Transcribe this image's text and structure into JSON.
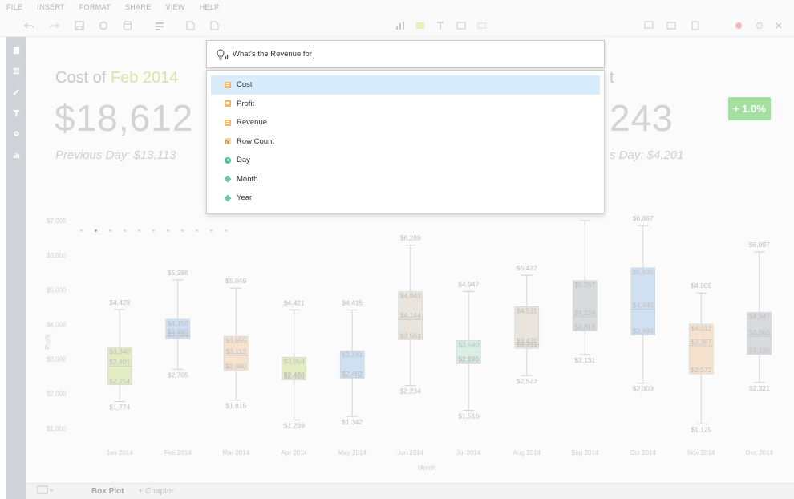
{
  "menu": [
    "FILE",
    "INSERT",
    "FORMAT",
    "SHARE",
    "VIEW",
    "HELP"
  ],
  "kpi_left": {
    "title_prefix": "Cost of ",
    "title_highlight": "Feb 2014",
    "value": "$18,612",
    "previous": "Previous Day: $13,113"
  },
  "kpi_right": {
    "title_partial": "t",
    "value_partial": "243",
    "previous_partial": "s Day: $4,201",
    "badge": "+ 1.0%"
  },
  "query": {
    "text": "What's the Revenue for"
  },
  "dropdown": [
    {
      "label": "Cost",
      "icon": "measure-icon",
      "selected": true
    },
    {
      "label": "Profit",
      "icon": "measure-icon",
      "selected": false
    },
    {
      "label": "Revenue",
      "icon": "measure-icon",
      "selected": false
    },
    {
      "label": "Row Count",
      "icon": "formula-icon",
      "selected": false
    },
    {
      "label": "Day",
      "icon": "time-dimension-icon",
      "selected": false
    },
    {
      "label": "Month",
      "icon": "dimension-icon",
      "selected": false
    },
    {
      "label": "Year",
      "icon": "dimension-icon",
      "selected": false
    }
  ],
  "bottom": {
    "active_tab": "Box Plot",
    "add_chapter": "+ Chapter"
  },
  "chart_data": {
    "type": "boxplot",
    "xlabel": "Month",
    "ylabel": "Profit",
    "ylim": [
      0,
      7000
    ],
    "yticks": [
      "$1,000",
      "$2,000",
      "$3,000",
      "$4,000",
      "$5,000",
      "$6,000",
      "$7,000"
    ],
    "categories": [
      "Jan 2014",
      "Feb 2014",
      "Mar 2014",
      "Apr 2014",
      "May 2014",
      "Jun 2014",
      "Jul 2014",
      "Aug 2014",
      "Sep 2014",
      "Oct 2014",
      "Nov 2014",
      "Dec 2014"
    ],
    "boxes": [
      {
        "min": 1774,
        "q1": 2254,
        "median": 2801,
        "q3": 3340,
        "max": 4428,
        "color": "#e4ecc2",
        "labels": [
          "$4,428",
          "$3,340",
          "$2,801",
          "$2,254",
          "$1,774"
        ]
      },
      {
        "min": 2705,
        "q1": 3584,
        "median": 3680,
        "q3": 4150,
        "max": 5286,
        "color": "#cfe0f3",
        "labels": [
          "$5,286",
          "$4,150",
          "$3,680",
          "$3,584",
          "$2,705"
        ]
      },
      {
        "min": 1815,
        "q1": 2680,
        "median": 3110,
        "q3": 3655,
        "max": 5049,
        "color": "#f5e3cf",
        "labels": [
          "$5,049",
          "$3,655",
          "$3,112",
          "$2,680",
          "$1,815"
        ]
      },
      {
        "min": 1239,
        "q1": 2400,
        "median": 2430,
        "q3": 3053,
        "max": 4421,
        "color": "#e4ecc2",
        "labels": [
          "$4,421",
          "$3,053",
          "$2,430",
          "$2,400",
          "$1,239"
        ]
      },
      {
        "min": 1342,
        "q1": 2452,
        "median": 2462,
        "q3": 3241,
        "max": 4415,
        "color": "#cfe0f3",
        "labels": [
          "$4,415",
          "$3,241",
          "$2,462",
          "$2,452",
          "$1,342"
        ]
      },
      {
        "min": 2234,
        "q1": 3563,
        "median": 4144,
        "q3": 4943,
        "max": 6289,
        "color": "#e9e4dc",
        "labels": [
          "$6,289",
          "$4,943",
          "$4,144",
          "$3,563",
          "$2,234"
        ]
      },
      {
        "min": 1516,
        "q1": 2870,
        "median": 2890,
        "q3": 3540,
        "max": 4947,
        "color": "#d9efe6",
        "labels": [
          "$4,947",
          "$3,540",
          "$2,890",
          "$2,870",
          "$1,516"
        ]
      },
      {
        "min": 2522,
        "q1": 3311,
        "median": 3420,
        "q3": 4511,
        "max": 5422,
        "color": "#e9e4dc",
        "labels": [
          "$5,422",
          "$4,511",
          "$3,420",
          "$3,311",
          "$2,522"
        ]
      },
      {
        "min": 3131,
        "q1": 3818,
        "median": 4224,
        "q3": 5267,
        "max": 7000,
        "color": "#d8dadd",
        "labels": [
          "$5,267",
          "$4,224",
          "$3,818",
          "$3,131"
        ]
      },
      {
        "min": 2303,
        "q1": 3694,
        "median": 4440,
        "q3": 5635,
        "max": 6857,
        "color": "#cfe0f3",
        "labels": [
          "$6,857",
          "$5,635",
          "$4,440",
          "$3,694",
          "$2,303"
        ]
      },
      {
        "min": 1129,
        "q1": 2572,
        "median": 3387,
        "q3": 4012,
        "max": 4909,
        "color": "#f5e3cf",
        "labels": [
          "$4,909",
          "$4,012",
          "$3,387",
          "$2,572",
          "$1,129"
        ]
      },
      {
        "min": 2321,
        "q1": 3135,
        "median": 3663,
        "q3": 4347,
        "max": 6097,
        "color": "#d8dadd",
        "labels": [
          "$6,097",
          "$4,347",
          "$3,663",
          "$3,135",
          "$2,321"
        ]
      }
    ]
  }
}
